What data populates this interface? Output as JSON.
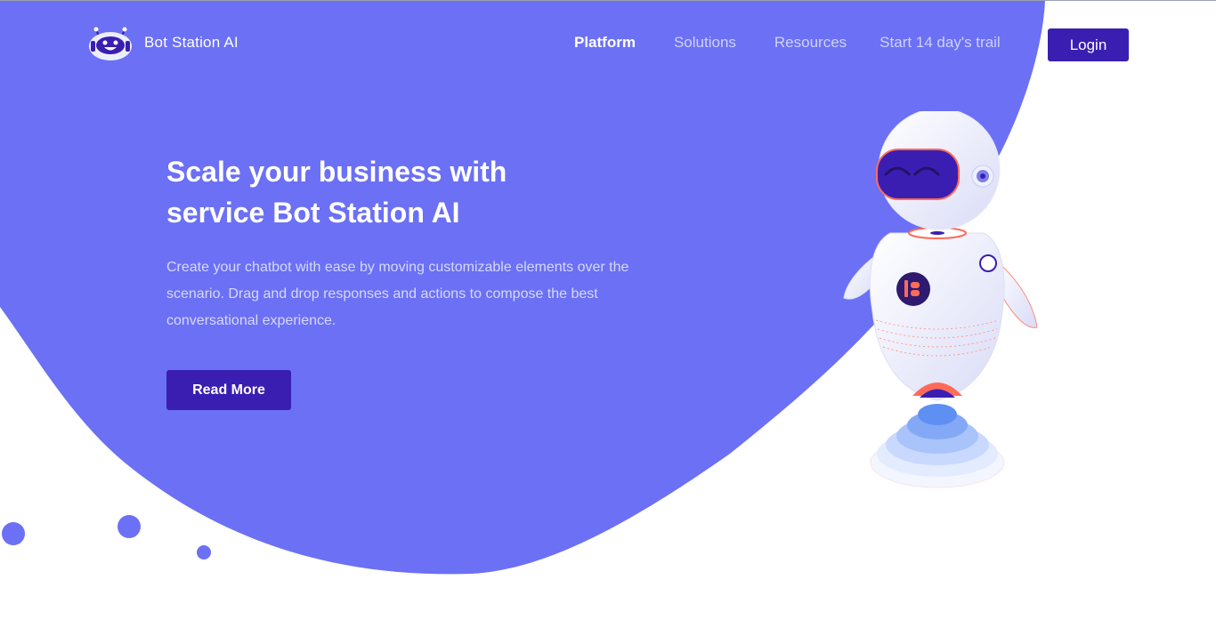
{
  "brand": {
    "name": "Bot Station AI",
    "logo_icon": "robot-head-icon"
  },
  "nav": {
    "links": [
      {
        "label": "Platform",
        "active": true
      },
      {
        "label": "Solutions",
        "active": false
      },
      {
        "label": "Resources",
        "active": false
      },
      {
        "label": "Start 14 day's trail",
        "active": false
      }
    ],
    "login_label": "Login"
  },
  "hero": {
    "title": "Scale your business with service Bot Station AI",
    "description": "Create your chatbot with ease by moving customizable elements over the scenario. Drag and drop responses and actions to compose the best conversational experience.",
    "cta_label": "Read More"
  },
  "illustration": {
    "name": "robot-illustration",
    "chest_logo": "Bot Station badge"
  },
  "colors": {
    "primary_blob": "#6b70f5",
    "button": "#3a1eb2",
    "white": "#ffffff"
  }
}
